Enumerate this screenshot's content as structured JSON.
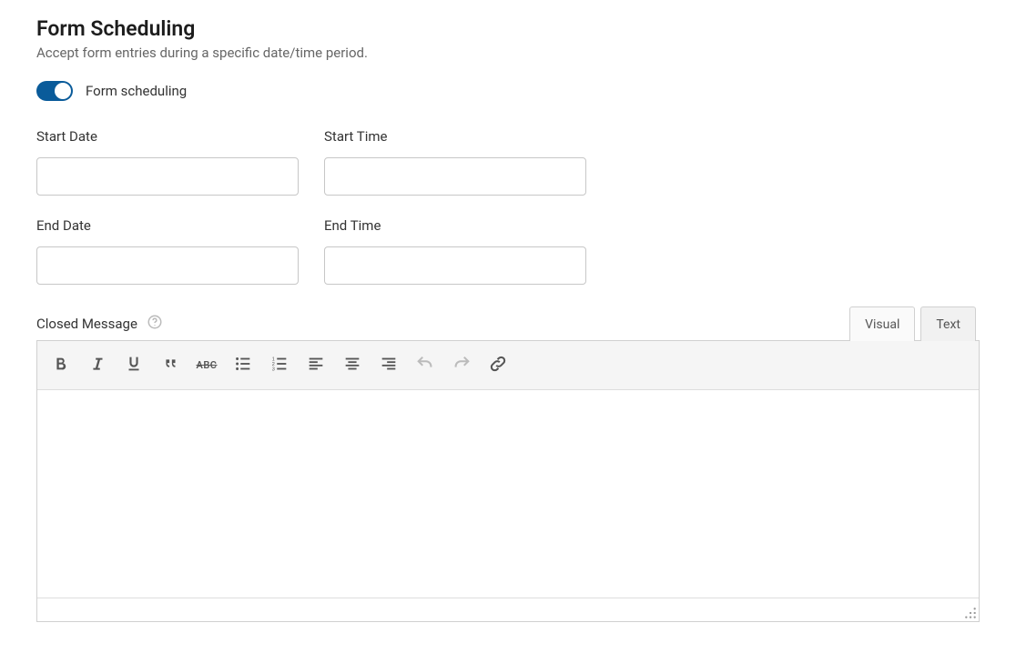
{
  "title": "Form Scheduling",
  "description": "Accept form entries during a specific date/time period.",
  "toggle": {
    "label": "Form scheduling",
    "enabled": true
  },
  "fields": {
    "start_date": {
      "label": "Start Date",
      "value": ""
    },
    "start_time": {
      "label": "Start Time",
      "value": ""
    },
    "end_date": {
      "label": "End Date",
      "value": ""
    },
    "end_time": {
      "label": "End Time",
      "value": ""
    }
  },
  "closed_message": {
    "label": "Closed Message",
    "value": ""
  },
  "editor": {
    "tabs": {
      "visual": "Visual",
      "text": "Text",
      "active": "visual"
    },
    "toolbar": {
      "bold": "Bold",
      "italic": "Italic",
      "underline": "Underline",
      "quote": "Blockquote",
      "strike": "Strikethrough",
      "ul": "Bulleted list",
      "ol": "Numbered list",
      "align_left": "Align left",
      "align_center": "Align center",
      "align_right": "Align right",
      "undo": "Undo",
      "redo": "Redo",
      "link": "Insert link",
      "strike_glyph": "ABC"
    }
  }
}
